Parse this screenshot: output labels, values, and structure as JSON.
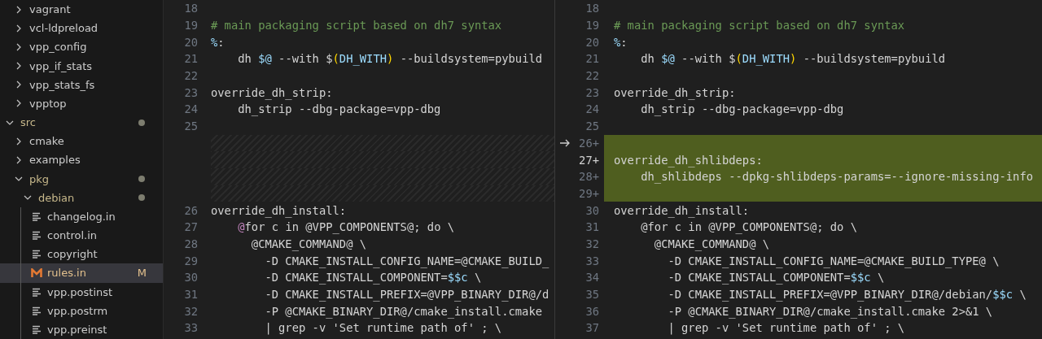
{
  "explorer": {
    "partial_group": [
      {
        "label": "vagrant",
        "kind": "folder",
        "expanded": false,
        "modified": false,
        "selected": false
      },
      {
        "label": "vcl-ldpreload",
        "kind": "folder",
        "expanded": false,
        "modified": false,
        "selected": false
      },
      {
        "label": "vpp_config",
        "kind": "folder",
        "expanded": false,
        "modified": false,
        "selected": false
      },
      {
        "label": "vpp_if_stats",
        "kind": "folder",
        "expanded": false,
        "modified": false,
        "selected": false
      },
      {
        "label": "vpp_stats_fs",
        "kind": "folder",
        "expanded": false,
        "modified": false,
        "selected": false
      },
      {
        "label": "vpptop",
        "kind": "folder",
        "expanded": false,
        "modified": false,
        "selected": false
      }
    ],
    "items": [
      {
        "label": "src",
        "kind": "folder",
        "expanded": true,
        "modified": true,
        "selected": false,
        "children": [
          {
            "label": "cmake",
            "kind": "folder",
            "expanded": false,
            "modified": false,
            "selected": false
          },
          {
            "label": "examples",
            "kind": "folder",
            "expanded": false,
            "modified": false,
            "selected": false
          },
          {
            "label": "pkg",
            "kind": "folder",
            "expanded": true,
            "modified": true,
            "selected": false,
            "children": [
              {
                "label": "debian",
                "kind": "folder",
                "expanded": true,
                "modified": true,
                "selected": false,
                "children": [
                  {
                    "label": "changelog.in",
                    "kind": "file",
                    "modified": false,
                    "selected": false
                  },
                  {
                    "label": "control.in",
                    "kind": "file",
                    "modified": false,
                    "selected": false
                  },
                  {
                    "label": "copyright",
                    "kind": "file",
                    "modified": false,
                    "selected": false
                  },
                  {
                    "label": "rules.in",
                    "kind": "makefile",
                    "modified": true,
                    "status": "M",
                    "selected": true
                  },
                  {
                    "label": "vpp.postinst",
                    "kind": "file",
                    "modified": false,
                    "selected": false
                  },
                  {
                    "label": "vpp.postrm",
                    "kind": "file",
                    "modified": false,
                    "selected": false
                  },
                  {
                    "label": "vpp.preinst",
                    "kind": "file",
                    "modified": false,
                    "selected": false
                  }
                ]
              }
            ]
          }
        ]
      }
    ]
  },
  "diff": {
    "original": [
      {
        "kind": "code",
        "number": "18"
      },
      {
        "kind": "code",
        "number": "19",
        "segments": [
          {
            "text": "# main packaging script based on dh7 syntax",
            "kind": "comment"
          }
        ]
      },
      {
        "kind": "code",
        "number": "20",
        "segments": [
          {
            "text": "%",
            "kind": "variable"
          },
          {
            "text": ":",
            "kind": "plain"
          }
        ]
      },
      {
        "kind": "code",
        "number": "21",
        "segments": [
          {
            "text": "    dh ",
            "kind": "plain"
          },
          {
            "text": "$@",
            "kind": "variable"
          },
          {
            "text": " --with $",
            "kind": "plain"
          },
          {
            "text": "(",
            "kind": "paren"
          },
          {
            "text": "DH_WITH",
            "kind": "variable"
          },
          {
            "text": ")",
            "kind": "paren"
          },
          {
            "text": " --buildsystem=pybuild",
            "kind": "plain"
          }
        ]
      },
      {
        "kind": "code",
        "number": "22"
      },
      {
        "kind": "code",
        "number": "23",
        "segments": [
          {
            "text": "override_dh_strip:",
            "kind": "plain"
          }
        ]
      },
      {
        "kind": "code",
        "number": "24",
        "segments": [
          {
            "text": "    dh_strip --dbg-package=vpp-dbg",
            "kind": "plain"
          }
        ]
      },
      {
        "kind": "code",
        "number": "25"
      },
      {
        "kind": "filler"
      },
      {
        "kind": "filler"
      },
      {
        "kind": "filler"
      },
      {
        "kind": "filler"
      },
      {
        "kind": "code",
        "number": "26",
        "segments": [
          {
            "text": "override_dh_install:",
            "kind": "plain"
          }
        ]
      },
      {
        "kind": "code",
        "number": "27",
        "segments": [
          {
            "text": "    @",
            "kind": "at"
          },
          {
            "text": "for c in @VPP_COMPONENTS@; do \\",
            "kind": "plain"
          }
        ]
      },
      {
        "kind": "code",
        "number": "28",
        "segments": [
          {
            "text": "      @CMAKE_COMMAND@ \\",
            "kind": "plain"
          }
        ]
      },
      {
        "kind": "code",
        "number": "29",
        "segments": [
          {
            "text": "        -D CMAKE_INSTALL_CONFIG_NAME=@CMAKE_BUILD_",
            "kind": "plain"
          }
        ]
      },
      {
        "kind": "code",
        "number": "30",
        "segments": [
          {
            "text": "        -D CMAKE_INSTALL_COMPONENT=",
            "kind": "plain"
          },
          {
            "text": "$$c",
            "kind": "variable"
          },
          {
            "text": " \\",
            "kind": "plain"
          }
        ]
      },
      {
        "kind": "code",
        "number": "31",
        "segments": [
          {
            "text": "        -D CMAKE_INSTALL_PREFIX=@VPP_BINARY_DIR@/d",
            "kind": "plain"
          }
        ]
      },
      {
        "kind": "code",
        "number": "32",
        "segments": [
          {
            "text": "        -P @CMAKE_BINARY_DIR@/cmake_install.cmake",
            "kind": "plain"
          }
        ]
      },
      {
        "kind": "code",
        "number": "33",
        "segments": [
          {
            "text": "        | grep -v 'Set runtime path of' ; \\",
            "kind": "plain"
          }
        ]
      }
    ],
    "modified": [
      {
        "kind": "code",
        "number": "18",
        "added": false,
        "arrow": false,
        "active": false
      },
      {
        "kind": "code",
        "number": "19",
        "added": false,
        "arrow": false,
        "active": false,
        "segments": [
          {
            "text": "# main packaging script based on dh7 syntax",
            "kind": "comment"
          }
        ]
      },
      {
        "kind": "code",
        "number": "20",
        "added": false,
        "arrow": false,
        "active": false,
        "segments": [
          {
            "text": "%",
            "kind": "variable"
          },
          {
            "text": ":",
            "kind": "plain"
          }
        ]
      },
      {
        "kind": "code",
        "number": "21",
        "added": false,
        "arrow": false,
        "active": false,
        "segments": [
          {
            "text": "    dh ",
            "kind": "plain"
          },
          {
            "text": "$@",
            "kind": "variable"
          },
          {
            "text": " --with $",
            "kind": "plain"
          },
          {
            "text": "(",
            "kind": "paren"
          },
          {
            "text": "DH_WITH",
            "kind": "variable"
          },
          {
            "text": ")",
            "kind": "paren"
          },
          {
            "text": " --buildsystem=pybuild",
            "kind": "plain"
          }
        ]
      },
      {
        "kind": "code",
        "number": "22",
        "added": false,
        "arrow": false,
        "active": false
      },
      {
        "kind": "code",
        "number": "23",
        "added": false,
        "arrow": false,
        "active": false,
        "segments": [
          {
            "text": "override_dh_strip:",
            "kind": "plain"
          }
        ]
      },
      {
        "kind": "code",
        "number": "24",
        "added": false,
        "arrow": false,
        "active": false,
        "segments": [
          {
            "text": "    dh_strip --dbg-package=vpp-dbg",
            "kind": "plain"
          }
        ]
      },
      {
        "kind": "code",
        "number": "25",
        "added": false,
        "arrow": false,
        "active": false
      },
      {
        "kind": "code",
        "number": "26+",
        "added": true,
        "arrow": true,
        "active": false
      },
      {
        "kind": "code",
        "number": "27+",
        "added": true,
        "arrow": false,
        "active": true,
        "segments": [
          {
            "text": "override_dh_shlibdeps:",
            "kind": "plain"
          }
        ]
      },
      {
        "kind": "code",
        "number": "28+",
        "added": true,
        "arrow": false,
        "active": false,
        "segments": [
          {
            "text": "    dh_shlibdeps --dpkg-shlibdeps-params=--ignore-missing-info",
            "kind": "plain"
          }
        ]
      },
      {
        "kind": "code",
        "number": "29+",
        "added": true,
        "arrow": false,
        "active": false
      },
      {
        "kind": "code",
        "number": "30",
        "added": false,
        "arrow": false,
        "active": false,
        "segments": [
          {
            "text": "override_dh_install:",
            "kind": "plain"
          }
        ]
      },
      {
        "kind": "code",
        "number": "31",
        "added": false,
        "arrow": false,
        "active": false,
        "segments": [
          {
            "text": "    @for c in @VPP_COMPONENTS@; do \\",
            "kind": "plain"
          }
        ]
      },
      {
        "kind": "code",
        "number": "32",
        "added": false,
        "arrow": false,
        "active": false,
        "segments": [
          {
            "text": "      @CMAKE_COMMAND@ \\",
            "kind": "plain"
          }
        ]
      },
      {
        "kind": "code",
        "number": "33",
        "added": false,
        "arrow": false,
        "active": false,
        "segments": [
          {
            "text": "        -D CMAKE_INSTALL_CONFIG_NAME=@CMAKE_BUILD_TYPE@ \\",
            "kind": "plain"
          }
        ]
      },
      {
        "kind": "code",
        "number": "34",
        "added": false,
        "arrow": false,
        "active": false,
        "segments": [
          {
            "text": "        -D CMAKE_INSTALL_COMPONENT=",
            "kind": "plain"
          },
          {
            "text": "$$c",
            "kind": "variable"
          },
          {
            "text": " \\",
            "kind": "plain"
          }
        ]
      },
      {
        "kind": "code",
        "number": "35",
        "added": false,
        "arrow": false,
        "active": false,
        "segments": [
          {
            "text": "        -D CMAKE_INSTALL_PREFIX=@VPP_BINARY_DIR@/debian/",
            "kind": "plain"
          },
          {
            "text": "$$c",
            "kind": "variable"
          },
          {
            "text": " \\",
            "kind": "plain"
          }
        ]
      },
      {
        "kind": "code",
        "number": "36",
        "added": false,
        "arrow": false,
        "active": false,
        "segments": [
          {
            "text": "        -P @CMAKE_BINARY_DIR@/cmake_install.cmake 2>&1 \\",
            "kind": "plain"
          }
        ]
      },
      {
        "kind": "code",
        "number": "37",
        "added": false,
        "arrow": false,
        "active": false,
        "segments": [
          {
            "text": "        | grep -v 'Set runtime path of' ; \\",
            "kind": "plain"
          }
        ]
      }
    ]
  }
}
